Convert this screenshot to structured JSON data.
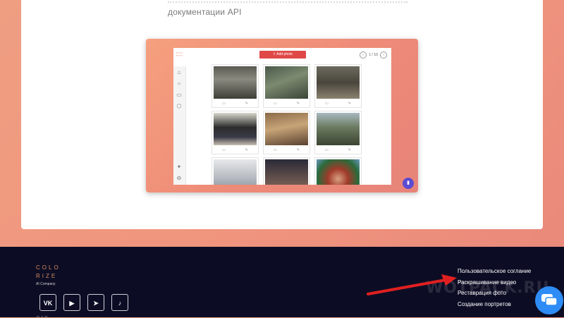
{
  "intro": {
    "text": "документации API"
  },
  "preview": {
    "add_photo_label": "Add photo",
    "pager_text": "1 / 10",
    "logo_text": "COLO\nRIZE"
  },
  "footer": {
    "brand_line1": "COLO",
    "brand_line2": "RIZE",
    "brand_sub": "AI Company",
    "socials": [
      {
        "name": "vk",
        "label": "VK"
      },
      {
        "name": "youtube",
        "label": "▶"
      },
      {
        "name": "telegram",
        "label": "➤"
      },
      {
        "name": "tiktok",
        "label": "♪"
      }
    ],
    "links": [
      "Пользовательское соглание",
      "Раскрашивание видео",
      "Реставрация фото",
      "Создание портретов"
    ],
    "watermark": "WOTPACK.RU"
  },
  "colors": {
    "accent_red": "#e04848",
    "footer_bg": "#0c0d24",
    "arrow": "#e02020",
    "chat": "#2e8cf6",
    "fab": "#5b4bd1"
  }
}
